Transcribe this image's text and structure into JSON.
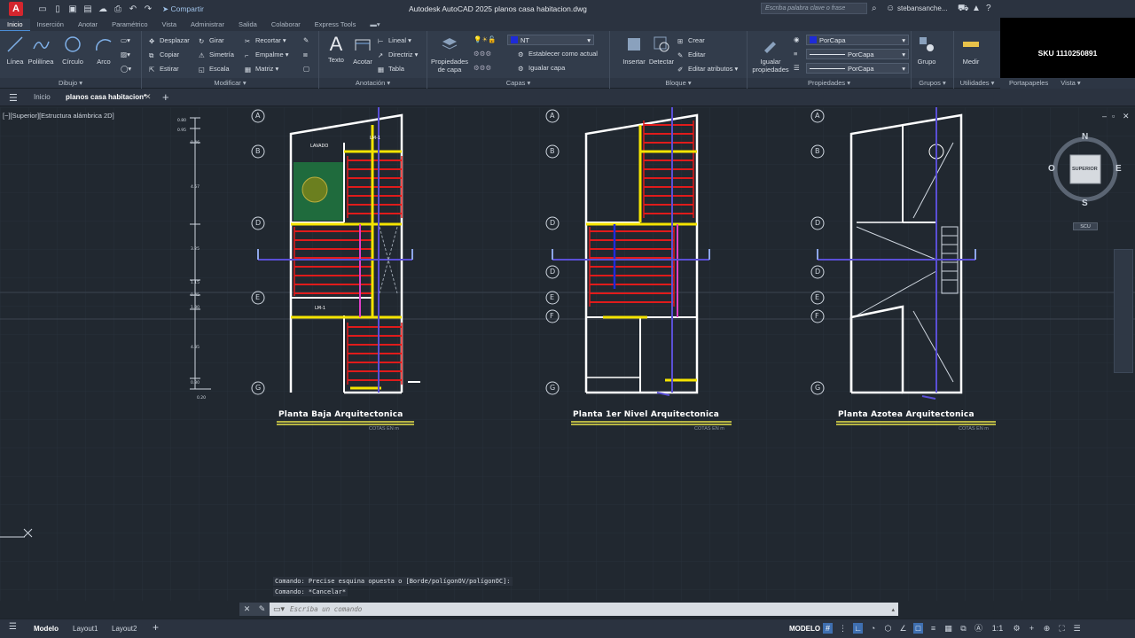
{
  "app": {
    "logo_letter": "A",
    "window_title": "Autodesk AutoCAD 2025   planos casa habitacion.dwg",
    "share_label": "Compartir",
    "search_placeholder": "Escriba palabra clave o frase",
    "user_name": "stebansanche..."
  },
  "ribbon_tabs": [
    "Inicio",
    "Inserción",
    "Anotar",
    "Paramétrico",
    "Vista",
    "Administrar",
    "Salida",
    "Colaborar",
    "Express Tools"
  ],
  "ribbon": {
    "dibujo": {
      "title": "Dibujo",
      "linea": "Línea",
      "polilinea": "Polilínea",
      "circulo": "Círculo",
      "arco": "Arco"
    },
    "modificar": {
      "title": "Modificar",
      "desplazar": "Desplazar",
      "girar": "Girar",
      "recortar": "Recortar",
      "copiar": "Copiar",
      "simetria": "Simetría",
      "empalme": "Empalme",
      "estirar": "Estirar",
      "escala": "Escala",
      "matriz": "Matriz"
    },
    "anotacion": {
      "title": "Anotación",
      "texto": "Texto",
      "acotar": "Acotar",
      "lineal": "Lineal",
      "directriz": "Directriz",
      "tabla": "Tabla"
    },
    "capas": {
      "title": "Capas",
      "propiedades": "Propiedades",
      "de_capa": "de capa",
      "layer_value": "NT",
      "establecer": "Establecer como actual",
      "igualar": "Igualar capa"
    },
    "bloque": {
      "title": "Bloque",
      "insertar": "Insertar",
      "detectar": "Detectar",
      "crear": "Crear",
      "editar": "Editar",
      "editar_atributos": "Editar atributos"
    },
    "propiedades": {
      "title": "Propiedades",
      "igualar": "Igualar",
      "propiedades": "propiedades",
      "color": "PorCapa",
      "linetype": "PorCapa",
      "lineweight": "PorCapa"
    },
    "grupos": {
      "title": "Grupos",
      "grupo": "Grupo"
    },
    "utilidades": {
      "title": "Utilidades",
      "medir": "Medir"
    },
    "portapapeles": {
      "title": "Portapapeles"
    },
    "vista": {
      "title": "Vista"
    }
  },
  "sku": "SKU 1110250891",
  "file_tabs": {
    "inicio": "Inicio",
    "active": "planos casa habitacion*"
  },
  "viewport_label": "[−][Superior][Estructura alámbrica 2D]",
  "plans": [
    {
      "title": "Planta  Baja Arquitectonica",
      "subtitle": "COTAS EN m"
    },
    {
      "title": "Planta  1er Nivel Arquitectonica",
      "subtitle": "COTAS EN m"
    },
    {
      "title": "Planta  Azotea Arquitectonica",
      "subtitle": "COTAS EN m"
    }
  ],
  "plan_labels": {
    "lavado": "LAVADO",
    "lm1": "LM-1"
  },
  "grid_axes": [
    "A",
    "B",
    "D",
    "E",
    "F",
    "G"
  ],
  "dimensions": [
    "0.80",
    "0.95",
    "0.46",
    "4.57",
    "3.25",
    "1.15",
    "0.45",
    "1.30",
    "4.35",
    "0.30",
    "0.20"
  ],
  "viewcube": {
    "north": "N",
    "south": "S",
    "east": "E",
    "west": "O",
    "face": "SUPERIOR",
    "ucs": "SCU"
  },
  "command_line": {
    "history": [
      "Comando: Precise esquina opuesta o [Borde/polígonOV/polígonOC]:",
      "Comando: *Cancelar*"
    ],
    "placeholder": "Escriba un comando"
  },
  "status": {
    "model_tab": "Modelo",
    "layout1": "Layout1",
    "layout2": "Layout2",
    "mode": "MODELO",
    "scale": "1:1"
  }
}
